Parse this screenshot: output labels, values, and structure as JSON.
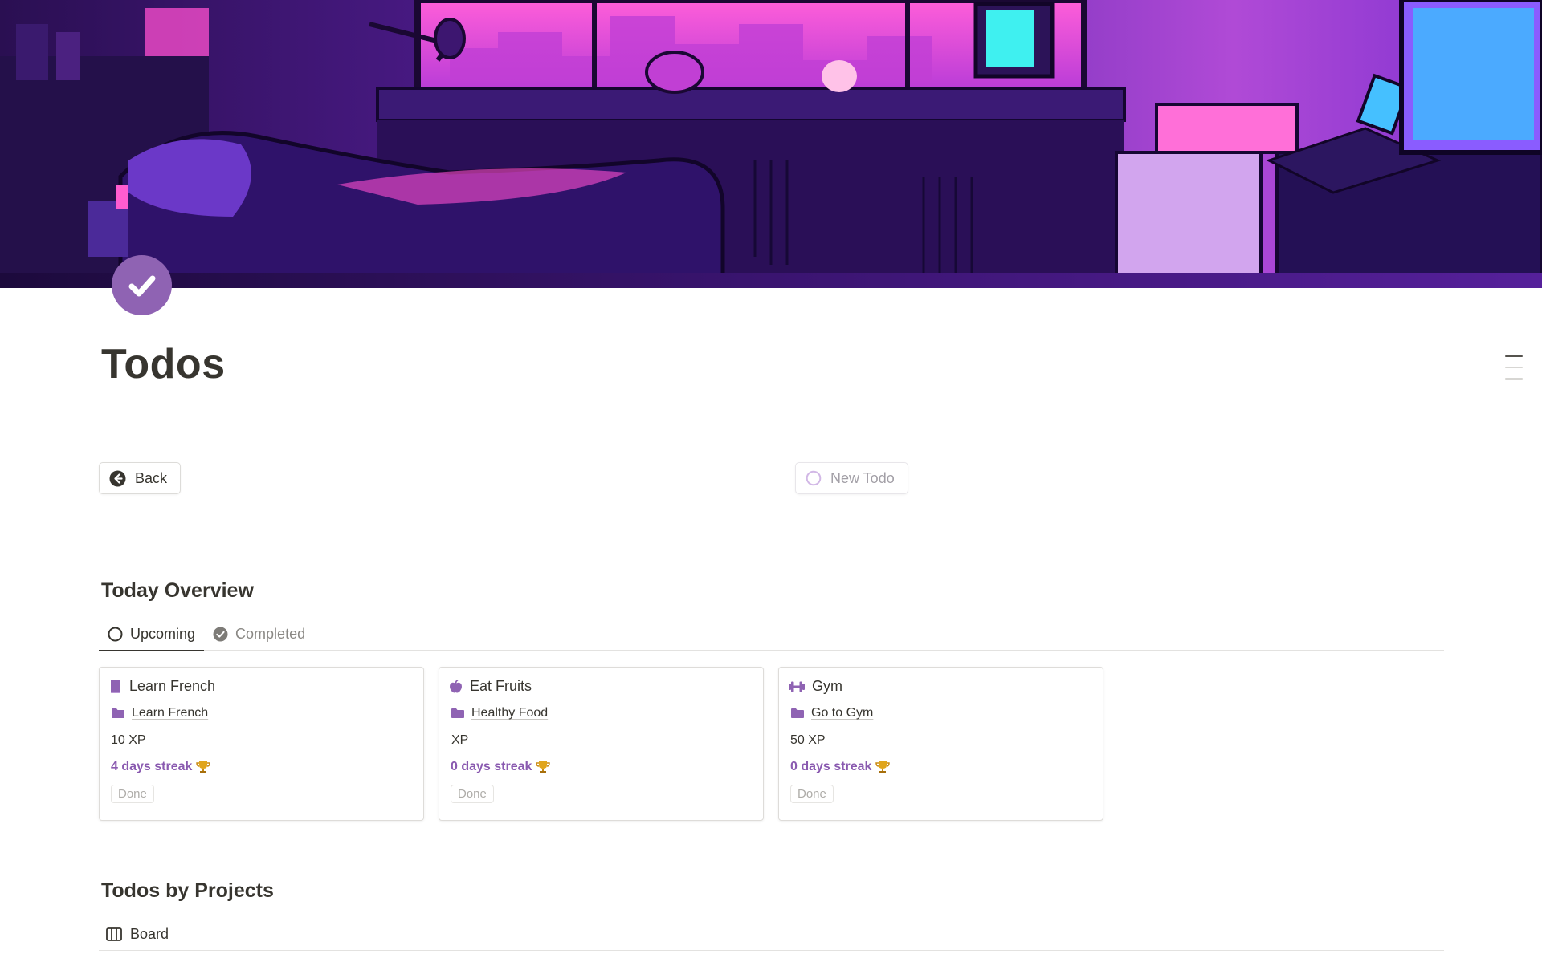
{
  "page": {
    "title": "Todos",
    "icon": "checkmark-circle-icon",
    "cover_image": "purple-night-bedroom-illustration"
  },
  "buttons": {
    "back_label": "Back",
    "new_todo_label": "New Todo"
  },
  "today_overview": {
    "heading": "Today Overview",
    "tabs": [
      {
        "label": "Upcoming",
        "icon": "circle-outline-icon",
        "active": true
      },
      {
        "label": "Completed",
        "icon": "check-circle-icon",
        "active": false
      }
    ],
    "cards": [
      {
        "title": "Learn French",
        "icon": "book-icon",
        "project": "Learn French",
        "xp": "10 XP",
        "streak": "4 days streak",
        "done_label": "Done"
      },
      {
        "title": "Eat Fruits",
        "icon": "apple-icon",
        "project": "Healthy Food",
        "xp": "XP",
        "streak": "0 days streak",
        "done_label": "Done"
      },
      {
        "title": "Gym",
        "icon": "dumbbell-icon",
        "project": "Go to Gym",
        "xp": "50 XP",
        "streak": "0 days streak",
        "done_label": "Done"
      }
    ]
  },
  "todos_by_projects": {
    "heading": "Todos by Projects",
    "view_label": "Board",
    "view_icon": "board-columns-icon"
  },
  "colors": {
    "accent_purple": "#8a5ab0",
    "icon_purple": "#8f63b3",
    "text": "#37352f",
    "muted": "#8a8884"
  }
}
